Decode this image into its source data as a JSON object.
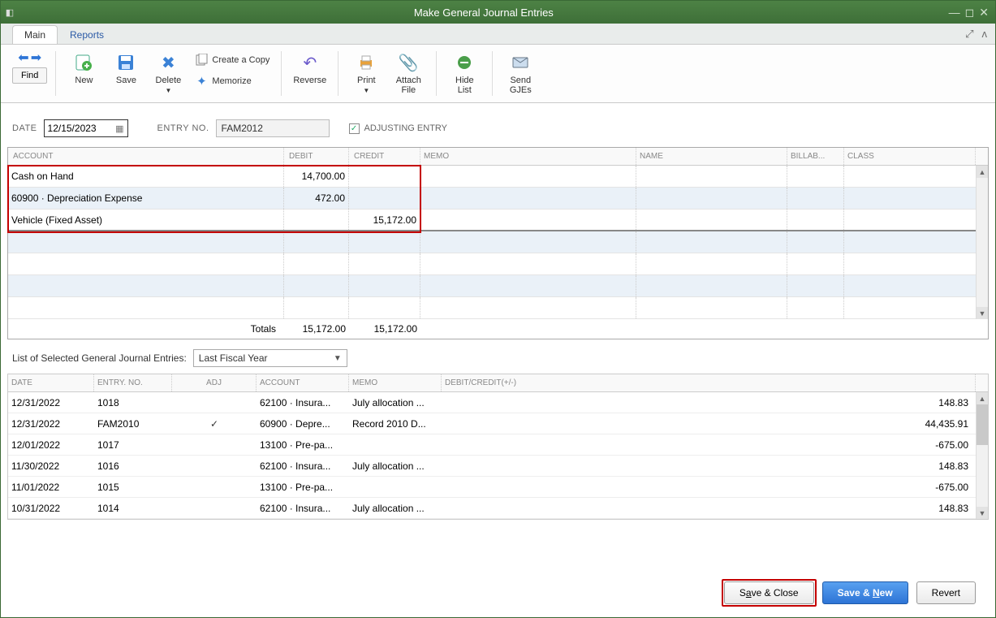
{
  "window": {
    "title": "Make General Journal Entries"
  },
  "tabs": {
    "main": "Main",
    "reports": "Reports"
  },
  "toolbar": {
    "find": "Find",
    "new": "New",
    "save": "Save",
    "delete": "Delete",
    "create_copy": "Create a Copy",
    "memorize": "Memorize",
    "reverse": "Reverse",
    "print": "Print",
    "attach_file": "Attach\nFile",
    "hide_list": "Hide\nList",
    "send_gjes": "Send\nGJEs"
  },
  "header": {
    "date_label": "DATE",
    "date_value": "12/15/2023",
    "entry_no_label": "ENTRY NO.",
    "entry_no_value": "FAM2012",
    "adjusting_label": "ADJUSTING ENTRY",
    "adjusting_checked": true
  },
  "grid": {
    "cols": {
      "account": "ACCOUNT",
      "debit": "DEBIT",
      "credit": "CREDIT",
      "memo": "MEMO",
      "name": "NAME",
      "billable": "BILLAB...",
      "class": "CLASS"
    },
    "rows": [
      {
        "account": "Cash on Hand",
        "debit": "14,700.00",
        "credit": ""
      },
      {
        "account": "60900 · Depreciation Expense",
        "debit": "472.00",
        "credit": ""
      },
      {
        "account": "Vehicle (Fixed Asset)",
        "debit": "",
        "credit": "15,172.00"
      }
    ],
    "totals_label": "Totals",
    "total_debit": "15,172.00",
    "total_credit": "15,172.00"
  },
  "list": {
    "label": "List of Selected General Journal Entries:",
    "filter_value": "Last Fiscal Year",
    "cols": {
      "date": "DATE",
      "entry_no": "ENTRY. NO.",
      "adj": "ADJ",
      "account": "ACCOUNT",
      "memo": "MEMO",
      "dc": "DEBIT/CREDIT(+/-)"
    },
    "rows": [
      {
        "date": "12/31/2022",
        "entry_no": "1018",
        "adj": "",
        "account": "62100 · Insura...",
        "memo": "July allocation ...",
        "dc": "148.83"
      },
      {
        "date": "12/31/2022",
        "entry_no": "FAM2010",
        "adj": "✓",
        "account": "60900 · Depre...",
        "memo": "Record 2010 D...",
        "dc": "44,435.91"
      },
      {
        "date": "12/01/2022",
        "entry_no": "1017",
        "adj": "",
        "account": "13100 · Pre-pa...",
        "memo": "",
        "dc": "-675.00"
      },
      {
        "date": "11/30/2022",
        "entry_no": "1016",
        "adj": "",
        "account": "62100 · Insura...",
        "memo": "July allocation ...",
        "dc": "148.83"
      },
      {
        "date": "11/01/2022",
        "entry_no": "1015",
        "adj": "",
        "account": "13100 · Pre-pa...",
        "memo": "",
        "dc": "-675.00"
      },
      {
        "date": "10/31/2022",
        "entry_no": "1014",
        "adj": "",
        "account": "62100 · Insura...",
        "memo": "July allocation ...",
        "dc": "148.83"
      }
    ]
  },
  "footer": {
    "save_close_pre": "S",
    "save_close_u": "a",
    "save_close_post": "ve & Close",
    "save_new_pre": "Save & ",
    "save_new_u": "N",
    "save_new_post": "ew",
    "revert": "Revert"
  }
}
